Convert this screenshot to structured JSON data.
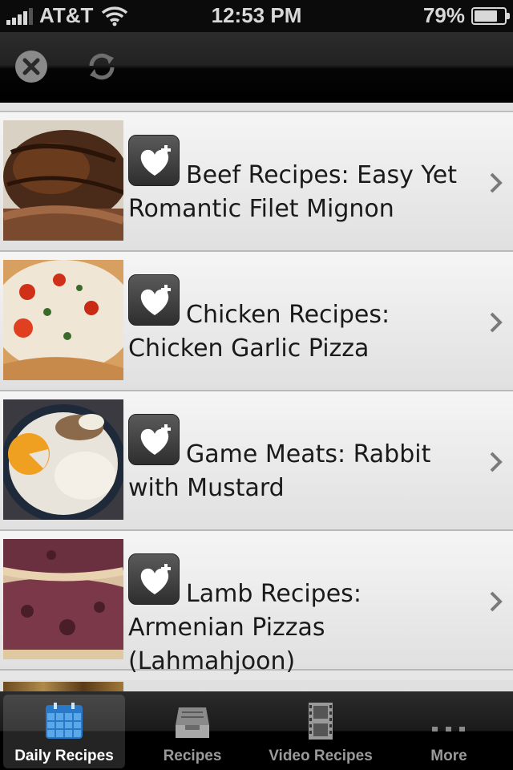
{
  "status_bar": {
    "carrier": "AT&T",
    "time": "12:53 PM",
    "battery": "79%",
    "battery_level": 0.79
  },
  "toolbar": {
    "close_icon": "close-circle-icon",
    "refresh_icon": "refresh-icon"
  },
  "recipes": [
    {
      "title": "Beef Recipes: Easy Yet Romantic Filet Mignon",
      "image": "steak"
    },
    {
      "title": "Chicken Recipes: Chicken Garlic Pizza",
      "image": "pizza"
    },
    {
      "title": "Game Meats: Rabbit with Mustard",
      "image": "plate"
    },
    {
      "title": "Lamb Recipes: Armenian Pizzas (Lahmahjoon)",
      "image": "lahmajoon"
    }
  ],
  "tabs": [
    {
      "label": "Daily Recipes",
      "icon": "calendar-icon",
      "active": true
    },
    {
      "label": "Recipes",
      "icon": "inbox-tray-icon",
      "active": false
    },
    {
      "label": "Video Recipes",
      "icon": "film-strip-icon",
      "active": false
    },
    {
      "label": "More",
      "icon": "more-dots-icon",
      "active": false
    }
  ],
  "colors": {
    "active_tab_icon": "#5aa8e8",
    "row_background": "#ececec",
    "fav_button": "#3c3c3c"
  }
}
